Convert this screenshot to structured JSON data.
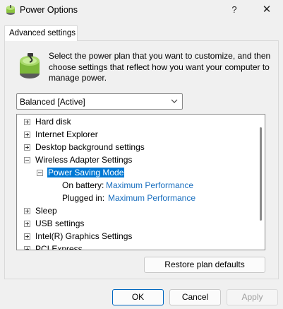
{
  "window": {
    "title": "Power Options",
    "help_glyph": "?",
    "close_glyph": "✕"
  },
  "tab": {
    "label": "Advanced settings"
  },
  "description": "Select the power plan that you want to customize, and then choose settings that reflect how you want your computer to manage power.",
  "plan_select": {
    "value": "Balanced [Active]"
  },
  "tree": {
    "items": [
      {
        "label": "Hard disk",
        "expander": "+"
      },
      {
        "label": "Internet Explorer",
        "expander": "+"
      },
      {
        "label": "Desktop background settings",
        "expander": "+"
      },
      {
        "label": "Wireless Adapter Settings",
        "expander": "-"
      },
      {
        "label": "Power Saving Mode",
        "expander": "-"
      },
      {
        "label": "On battery:",
        "value": "Maximum Performance"
      },
      {
        "label": "Plugged in:",
        "value": "Maximum Performance"
      },
      {
        "label": "Sleep",
        "expander": "+"
      },
      {
        "label": "USB settings",
        "expander": "+"
      },
      {
        "label": "Intel(R) Graphics Settings",
        "expander": "+"
      },
      {
        "label": "PCI Express",
        "expander": "+"
      }
    ]
  },
  "buttons": {
    "restore": "Restore plan defaults",
    "ok": "OK",
    "cancel": "Cancel",
    "apply": "Apply"
  },
  "colors": {
    "selection": "#0078d4",
    "link": "#1a6fbf",
    "accent_border": "#0067c0"
  }
}
